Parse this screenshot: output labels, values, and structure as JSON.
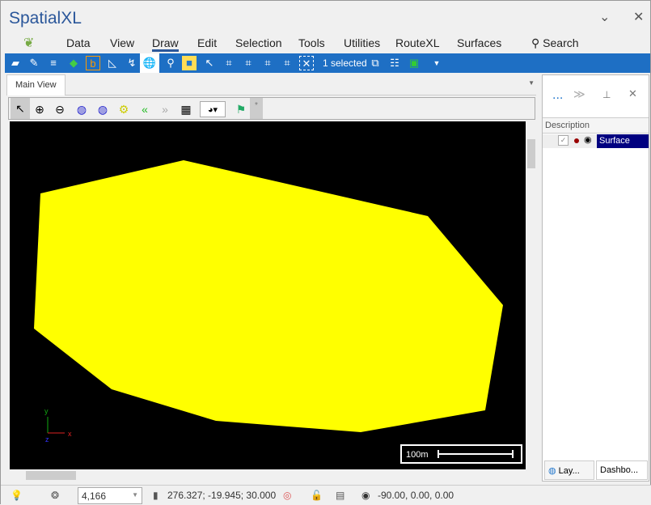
{
  "app": {
    "title": "SpatialXL"
  },
  "window": {
    "minimize_icon": "chevron-down",
    "close_icon": "close"
  },
  "menu": {
    "items": [
      "Data",
      "View",
      "Draw",
      "Edit",
      "Selection",
      "Tools",
      "Utilities",
      "RouteXL",
      "Surfaces"
    ],
    "active": "Draw",
    "search": "Search"
  },
  "toolbar": {
    "selection_label": "1 selected"
  },
  "tabs": {
    "main": "Main View"
  },
  "canvas": {
    "scale_label": "100m",
    "axis_x": "x",
    "axis_y": "y",
    "axis_z": "z",
    "surface_color": "#ffff00",
    "background": "#000000"
  },
  "panel": {
    "more": "...",
    "column": "Description",
    "layer": {
      "name": "Surface",
      "checked": true
    },
    "tabs": [
      "Lay...",
      "Dashbo..."
    ]
  },
  "status": {
    "zoom_value": "4,166",
    "cursor": "276.327; -19.945; 30.000",
    "view_angles": "-90.00, 0.00, 0.00"
  },
  "colors": {
    "accent": "#1e6fc4",
    "selection": "#000080"
  }
}
